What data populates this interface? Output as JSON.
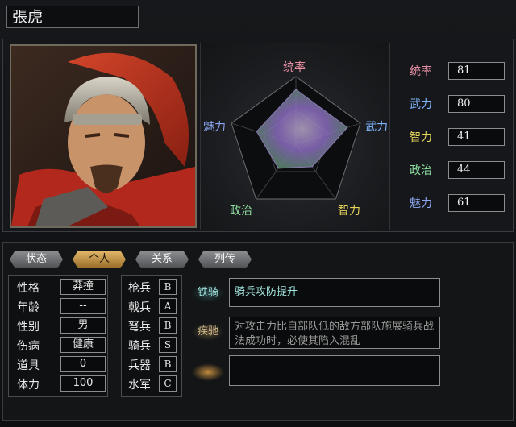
{
  "character": {
    "name": "張虎"
  },
  "radar": {
    "labels": {
      "tongshuai": "统率",
      "wuli": "武力",
      "zhili": "智力",
      "zhengzhi": "政治",
      "meili": "魅力"
    },
    "values": {
      "tongshuai": 81,
      "wuli": 80,
      "zhili": 41,
      "zhengzhi": 44,
      "meili": 61
    },
    "max": 100
  },
  "stats": [
    {
      "label": "统率",
      "value": "81",
      "color": "#e58fa4"
    },
    {
      "label": "武力",
      "value": "80",
      "color": "#7fb6ff"
    },
    {
      "label": "智力",
      "value": "41",
      "color": "#e7d55b"
    },
    {
      "label": "政治",
      "value": "44",
      "color": "#8fe0a2"
    },
    {
      "label": "魅力",
      "value": "61",
      "color": "#8ca7f2"
    }
  ],
  "tabs": [
    "状态",
    "个人",
    "关系",
    "列传"
  ],
  "active_tab": "个人",
  "personal": [
    {
      "label": "性格",
      "value": "莽撞"
    },
    {
      "label": "年龄",
      "value": "--"
    },
    {
      "label": "性别",
      "value": "男"
    },
    {
      "label": "伤病",
      "value": "健康"
    },
    {
      "label": "道具",
      "value": "0"
    },
    {
      "label": "体力",
      "value": "100"
    }
  ],
  "aptitude": [
    {
      "label": "枪兵",
      "value": "B"
    },
    {
      "label": "戟兵",
      "value": "A"
    },
    {
      "label": "弩兵",
      "value": "B"
    },
    {
      "label": "骑兵",
      "value": "S"
    },
    {
      "label": "兵器",
      "value": "B"
    },
    {
      "label": "水军",
      "value": "C"
    }
  ],
  "skills": [
    {
      "tag": "铁骑",
      "text": "骑兵攻防提升"
    },
    {
      "tag": "疾驰",
      "text": "对攻击力比自部队低的敌方部队施展骑兵战法成功时，必使其陷入混乱"
    },
    {
      "tag": "",
      "text": ""
    }
  ]
}
